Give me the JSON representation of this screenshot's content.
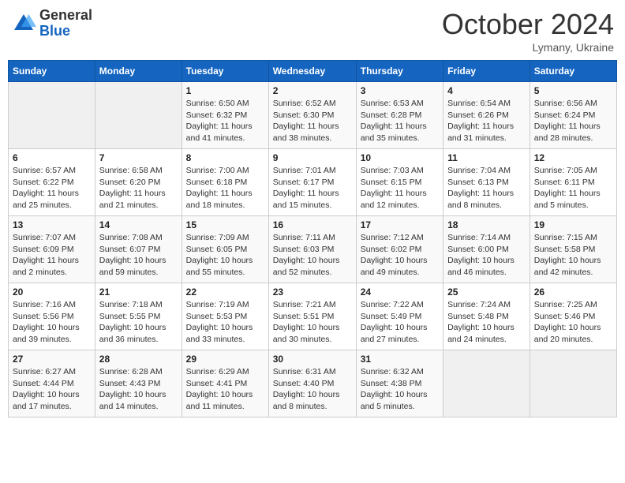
{
  "header": {
    "logo_general": "General",
    "logo_blue": "Blue",
    "month_title": "October 2024",
    "subtitle": "Lymany, Ukraine"
  },
  "days_of_week": [
    "Sunday",
    "Monday",
    "Tuesday",
    "Wednesday",
    "Thursday",
    "Friday",
    "Saturday"
  ],
  "weeks": [
    [
      {
        "day": "",
        "sunrise": "",
        "sunset": "",
        "daylight": ""
      },
      {
        "day": "",
        "sunrise": "",
        "sunset": "",
        "daylight": ""
      },
      {
        "day": "1",
        "sunrise": "Sunrise: 6:50 AM",
        "sunset": "Sunset: 6:32 PM",
        "daylight": "Daylight: 11 hours and 41 minutes."
      },
      {
        "day": "2",
        "sunrise": "Sunrise: 6:52 AM",
        "sunset": "Sunset: 6:30 PM",
        "daylight": "Daylight: 11 hours and 38 minutes."
      },
      {
        "day": "3",
        "sunrise": "Sunrise: 6:53 AM",
        "sunset": "Sunset: 6:28 PM",
        "daylight": "Daylight: 11 hours and 35 minutes."
      },
      {
        "day": "4",
        "sunrise": "Sunrise: 6:54 AM",
        "sunset": "Sunset: 6:26 PM",
        "daylight": "Daylight: 11 hours and 31 minutes."
      },
      {
        "day": "5",
        "sunrise": "Sunrise: 6:56 AM",
        "sunset": "Sunset: 6:24 PM",
        "daylight": "Daylight: 11 hours and 28 minutes."
      }
    ],
    [
      {
        "day": "6",
        "sunrise": "Sunrise: 6:57 AM",
        "sunset": "Sunset: 6:22 PM",
        "daylight": "Daylight: 11 hours and 25 minutes."
      },
      {
        "day": "7",
        "sunrise": "Sunrise: 6:58 AM",
        "sunset": "Sunset: 6:20 PM",
        "daylight": "Daylight: 11 hours and 21 minutes."
      },
      {
        "day": "8",
        "sunrise": "Sunrise: 7:00 AM",
        "sunset": "Sunset: 6:18 PM",
        "daylight": "Daylight: 11 hours and 18 minutes."
      },
      {
        "day": "9",
        "sunrise": "Sunrise: 7:01 AM",
        "sunset": "Sunset: 6:17 PM",
        "daylight": "Daylight: 11 hours and 15 minutes."
      },
      {
        "day": "10",
        "sunrise": "Sunrise: 7:03 AM",
        "sunset": "Sunset: 6:15 PM",
        "daylight": "Daylight: 11 hours and 12 minutes."
      },
      {
        "day": "11",
        "sunrise": "Sunrise: 7:04 AM",
        "sunset": "Sunset: 6:13 PM",
        "daylight": "Daylight: 11 hours and 8 minutes."
      },
      {
        "day": "12",
        "sunrise": "Sunrise: 7:05 AM",
        "sunset": "Sunset: 6:11 PM",
        "daylight": "Daylight: 11 hours and 5 minutes."
      }
    ],
    [
      {
        "day": "13",
        "sunrise": "Sunrise: 7:07 AM",
        "sunset": "Sunset: 6:09 PM",
        "daylight": "Daylight: 11 hours and 2 minutes."
      },
      {
        "day": "14",
        "sunrise": "Sunrise: 7:08 AM",
        "sunset": "Sunset: 6:07 PM",
        "daylight": "Daylight: 10 hours and 59 minutes."
      },
      {
        "day": "15",
        "sunrise": "Sunrise: 7:09 AM",
        "sunset": "Sunset: 6:05 PM",
        "daylight": "Daylight: 10 hours and 55 minutes."
      },
      {
        "day": "16",
        "sunrise": "Sunrise: 7:11 AM",
        "sunset": "Sunset: 6:03 PM",
        "daylight": "Daylight: 10 hours and 52 minutes."
      },
      {
        "day": "17",
        "sunrise": "Sunrise: 7:12 AM",
        "sunset": "Sunset: 6:02 PM",
        "daylight": "Daylight: 10 hours and 49 minutes."
      },
      {
        "day": "18",
        "sunrise": "Sunrise: 7:14 AM",
        "sunset": "Sunset: 6:00 PM",
        "daylight": "Daylight: 10 hours and 46 minutes."
      },
      {
        "day": "19",
        "sunrise": "Sunrise: 7:15 AM",
        "sunset": "Sunset: 5:58 PM",
        "daylight": "Daylight: 10 hours and 42 minutes."
      }
    ],
    [
      {
        "day": "20",
        "sunrise": "Sunrise: 7:16 AM",
        "sunset": "Sunset: 5:56 PM",
        "daylight": "Daylight: 10 hours and 39 minutes."
      },
      {
        "day": "21",
        "sunrise": "Sunrise: 7:18 AM",
        "sunset": "Sunset: 5:55 PM",
        "daylight": "Daylight: 10 hours and 36 minutes."
      },
      {
        "day": "22",
        "sunrise": "Sunrise: 7:19 AM",
        "sunset": "Sunset: 5:53 PM",
        "daylight": "Daylight: 10 hours and 33 minutes."
      },
      {
        "day": "23",
        "sunrise": "Sunrise: 7:21 AM",
        "sunset": "Sunset: 5:51 PM",
        "daylight": "Daylight: 10 hours and 30 minutes."
      },
      {
        "day": "24",
        "sunrise": "Sunrise: 7:22 AM",
        "sunset": "Sunset: 5:49 PM",
        "daylight": "Daylight: 10 hours and 27 minutes."
      },
      {
        "day": "25",
        "sunrise": "Sunrise: 7:24 AM",
        "sunset": "Sunset: 5:48 PM",
        "daylight": "Daylight: 10 hours and 24 minutes."
      },
      {
        "day": "26",
        "sunrise": "Sunrise: 7:25 AM",
        "sunset": "Sunset: 5:46 PM",
        "daylight": "Daylight: 10 hours and 20 minutes."
      }
    ],
    [
      {
        "day": "27",
        "sunrise": "Sunrise: 6:27 AM",
        "sunset": "Sunset: 4:44 PM",
        "daylight": "Daylight: 10 hours and 17 minutes."
      },
      {
        "day": "28",
        "sunrise": "Sunrise: 6:28 AM",
        "sunset": "Sunset: 4:43 PM",
        "daylight": "Daylight: 10 hours and 14 minutes."
      },
      {
        "day": "29",
        "sunrise": "Sunrise: 6:29 AM",
        "sunset": "Sunset: 4:41 PM",
        "daylight": "Daylight: 10 hours and 11 minutes."
      },
      {
        "day": "30",
        "sunrise": "Sunrise: 6:31 AM",
        "sunset": "Sunset: 4:40 PM",
        "daylight": "Daylight: 10 hours and 8 minutes."
      },
      {
        "day": "31",
        "sunrise": "Sunrise: 6:32 AM",
        "sunset": "Sunset: 4:38 PM",
        "daylight": "Daylight: 10 hours and 5 minutes."
      },
      {
        "day": "",
        "sunrise": "",
        "sunset": "",
        "daylight": ""
      },
      {
        "day": "",
        "sunrise": "",
        "sunset": "",
        "daylight": ""
      }
    ]
  ]
}
